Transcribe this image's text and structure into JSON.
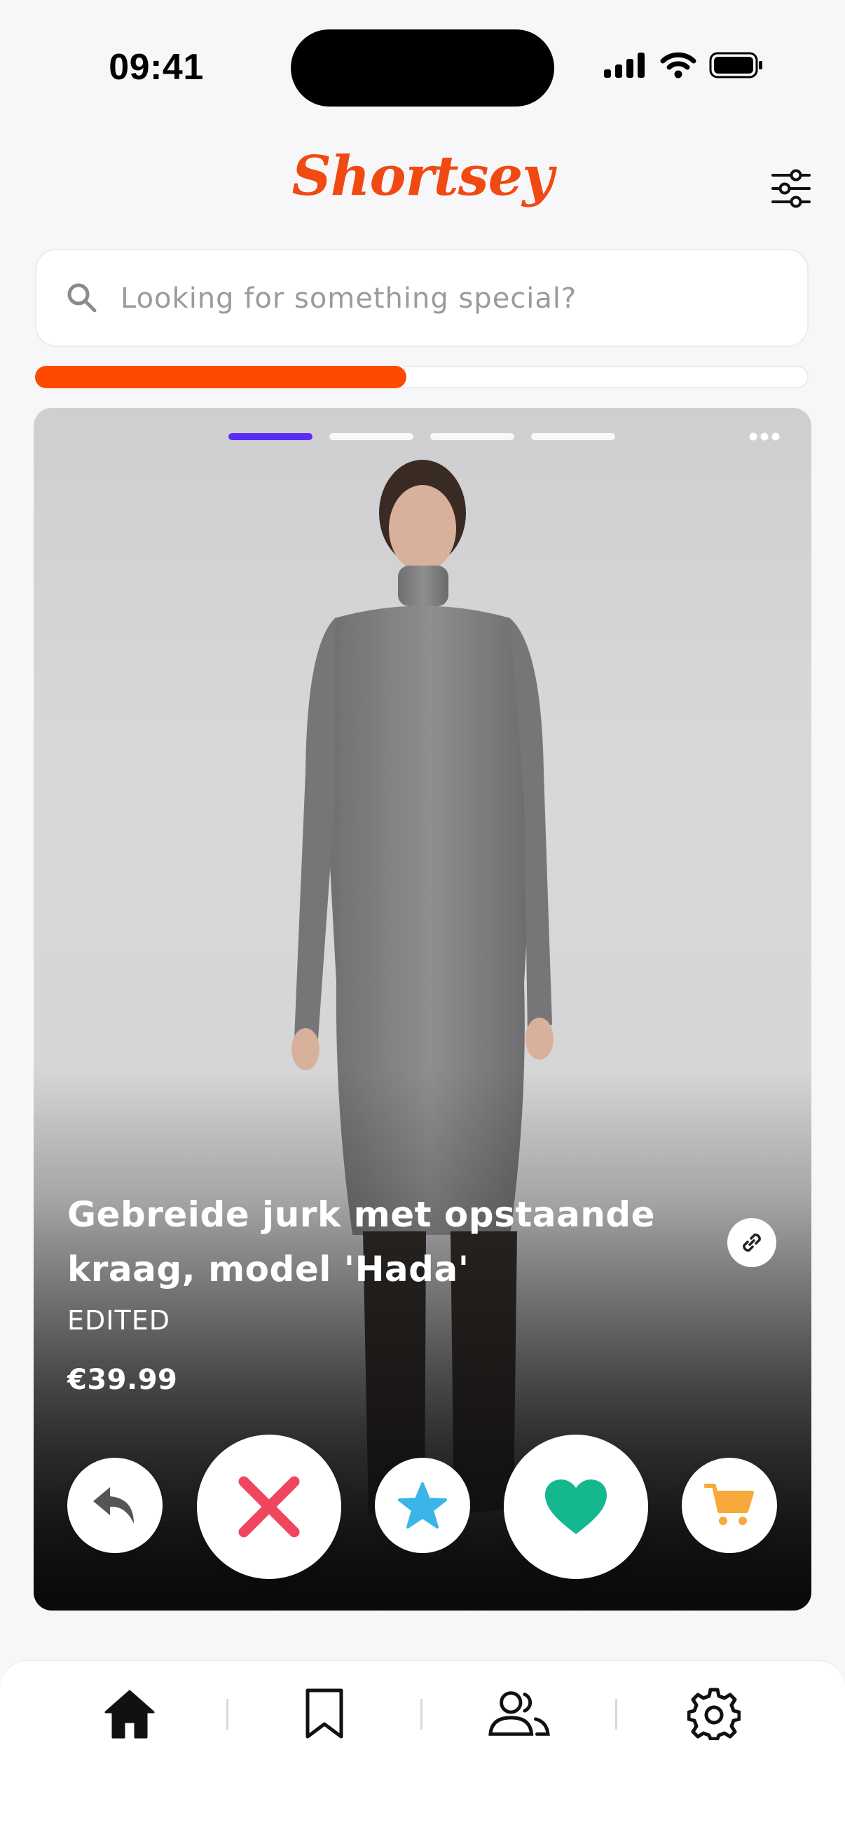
{
  "status_bar": {
    "time": "09:41"
  },
  "header": {
    "logo": "Shortsey"
  },
  "search": {
    "placeholder": "Looking for something special?"
  },
  "progress": {
    "fraction": 0.48
  },
  "card": {
    "image_pages": 4,
    "active_page": 1,
    "product_title": "Gebreide jurk met opstaande kraag, model 'Hada'",
    "brand": "EDITED",
    "price": "€39.99"
  },
  "actions": [
    {
      "name": "undo",
      "icon": "undo-arrow-icon",
      "color": "#555555"
    },
    {
      "name": "nope",
      "icon": "close-x-icon",
      "color": "#f0455e"
    },
    {
      "name": "super-like",
      "icon": "star-icon",
      "color": "#3bb5e8"
    },
    {
      "name": "like",
      "icon": "heart-icon",
      "color": "#15b88e"
    },
    {
      "name": "cart",
      "icon": "cart-icon",
      "color": "#f7a93b"
    }
  ],
  "nav": [
    {
      "name": "home",
      "icon": "home-icon",
      "active": true
    },
    {
      "name": "saved",
      "icon": "bookmark-icon",
      "active": false
    },
    {
      "name": "social",
      "icon": "users-icon",
      "active": false
    },
    {
      "name": "settings",
      "icon": "gear-icon",
      "active": false
    }
  ],
  "colors": {
    "accent": "#fe4a00",
    "page_indicator_active": "#5b2cf5",
    "background": "#f7f7fa"
  }
}
